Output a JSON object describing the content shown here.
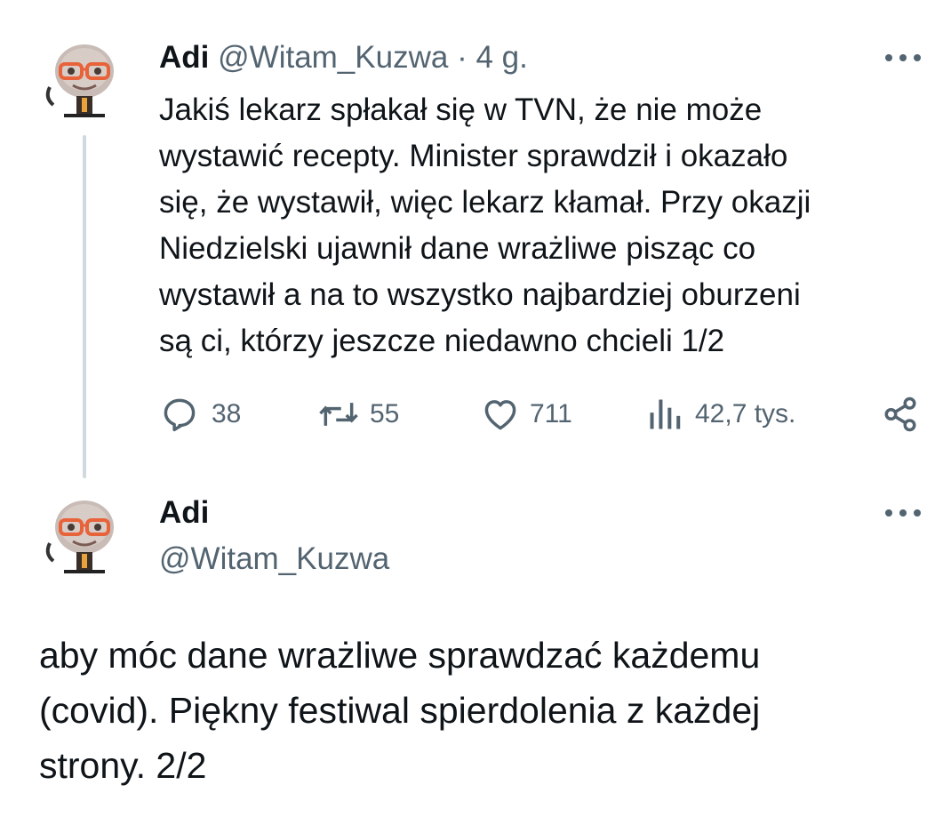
{
  "tweet1": {
    "author_name": "Adi",
    "handle": "@Witam_Kuzwa",
    "separator": "·",
    "time": "4 g.",
    "lines": [
      "Jakiś lekarz spłakał się w TVN, że nie może",
      "wystawić recepty. Minister sprawdził i okazało",
      "się, że wystawił, więc lekarz kłamał. Przy okazji",
      "Niedzielski ujawnił dane wrażliwe pisząc co",
      "wystawił a na to wszystko najbardziej oburzeni",
      "są ci, którzy jeszcze niedawno chcieli 1/2"
    ],
    "actions": {
      "replies": "38",
      "reposts": "55",
      "likes": "711",
      "views": "42,7 tys."
    }
  },
  "tweet2": {
    "author_name": "Adi",
    "handle": "@Witam_Kuzwa",
    "lines": [
      "aby móc dane wrażliwe sprawdzać każdemu",
      "(covid). Piękny festiwal spierdolenia z każdej",
      "strony. 2/2"
    ]
  },
  "icons": {
    "reply": "reply-icon",
    "repost": "repost-icon",
    "like": "heart-icon",
    "views": "views-icon",
    "share": "share-icon",
    "more": "more-icon"
  },
  "colors": {
    "text": "#0f1419",
    "secondary": "#536471",
    "thread_line": "#cfd9de",
    "background": "#ffffff"
  }
}
